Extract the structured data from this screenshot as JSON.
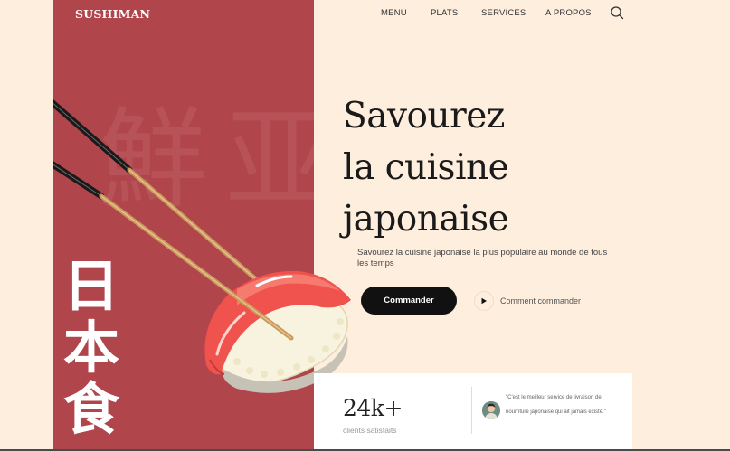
{
  "brand": {
    "logo": "SUSHIMAN"
  },
  "nav": {
    "items": [
      {
        "label": "MENU",
        "name": "nav-menu"
      },
      {
        "label": "PLATS",
        "name": "nav-plats"
      },
      {
        "label": "SERVICES",
        "name": "nav-services"
      },
      {
        "label": "A PROPOS",
        "name": "nav-a-propos"
      }
    ],
    "search_icon": "search-icon"
  },
  "hero": {
    "headline": [
      "Savourez",
      "la cuisine",
      "japonaise"
    ],
    "subtitle": "Savourez la cuisine japonaise la plus populaire au monde de tous les temps",
    "cta_label": "Commander",
    "secondary_label": "Comment commander",
    "secondary_icon": "play-icon"
  },
  "decor": {
    "vertical_kanji": [
      "日",
      "本",
      "食"
    ],
    "background_kanji": [
      "鮮",
      "亚"
    ]
  },
  "stats": {
    "number": "24k+",
    "label": "clients satisfaits"
  },
  "testimonial": {
    "quote": "\"C'est le meilleur service de livraison de nourriture japonaise qui ait jamais existé.\"",
    "avatar_icon": "avatar"
  },
  "colors": {
    "background": "#fdeedd",
    "panel": "#b1454c",
    "accent_dark": "#111111",
    "tuna": "#f0524d"
  }
}
